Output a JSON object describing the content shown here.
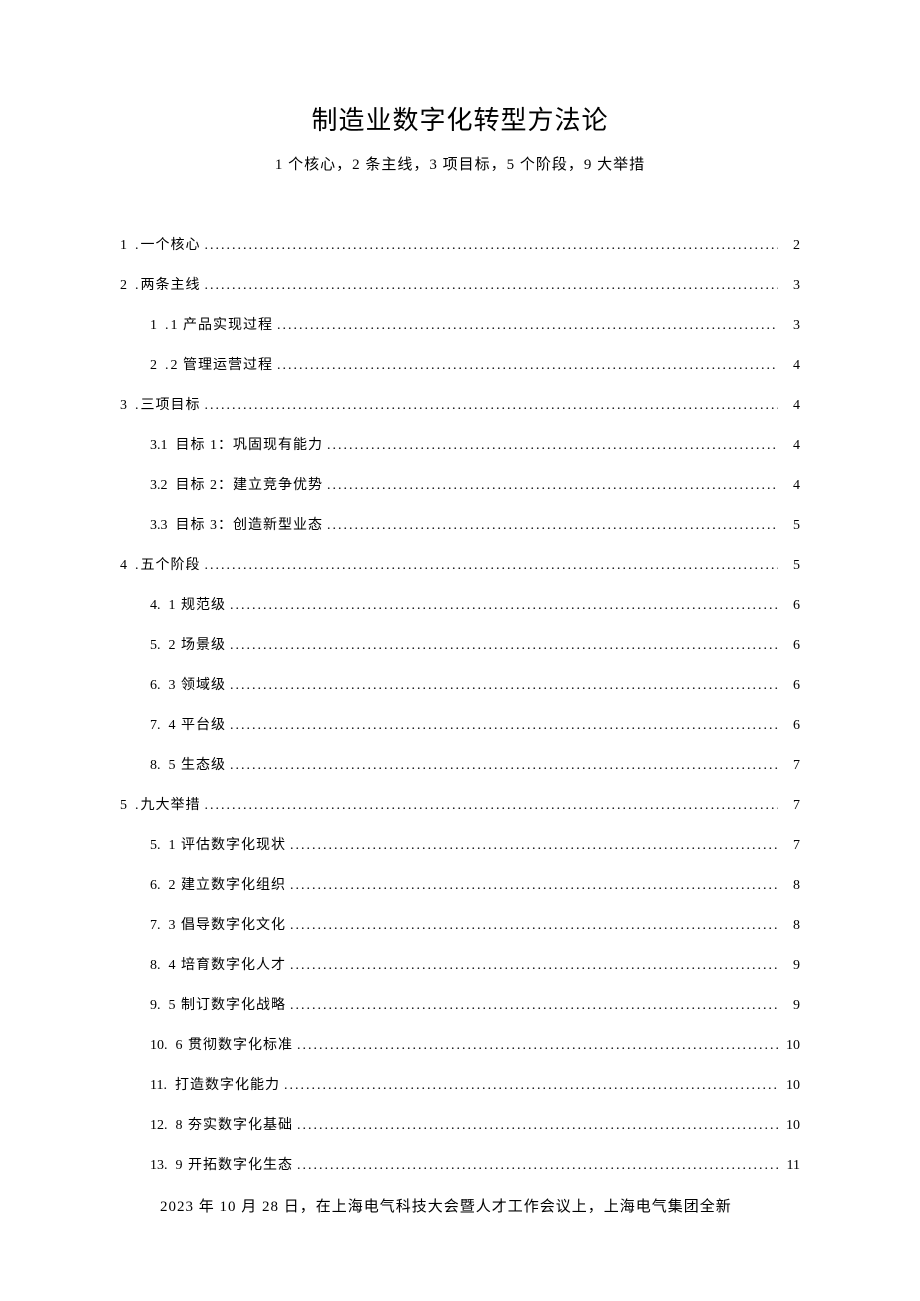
{
  "title": "制造业数字化转型方法论",
  "subtitle": "1 个核心，2 条主线，3 项目标，5 个阶段，9 大举措",
  "toc": [
    {
      "level": 1,
      "num": "1",
      "sep": "  .",
      "label": "一个核心",
      "page": "2"
    },
    {
      "level": 1,
      "num": "2",
      "sep": "  .",
      "label": "两条主线",
      "page": "3"
    },
    {
      "level": 2,
      "num": "1",
      "sep": "  .",
      "label": "1 产品实现过程",
      "page": "3"
    },
    {
      "level": 2,
      "num": "2",
      "sep": "  .",
      "label": "2 管理运营过程",
      "page": "4"
    },
    {
      "level": 1,
      "num": "3",
      "sep": "  .",
      "label": "三项目标",
      "page": "4"
    },
    {
      "level": 2,
      "num": "3.1",
      "sep": "",
      "label": "   目标 1：巩固现有能力",
      "page": "4"
    },
    {
      "level": 2,
      "num": "3.2",
      "sep": "",
      "label": "   目标 2：建立竞争优势",
      "page": "4"
    },
    {
      "level": 2,
      "num": "3.3",
      "sep": "",
      "label": "   目标 3：创造新型业态",
      "page": "5"
    },
    {
      "level": 1,
      "num": "4",
      "sep": "  .",
      "label": "五个阶段",
      "page": "5"
    },
    {
      "level": 2,
      "num": "4.",
      "sep": "",
      "label": "  1 规范级",
      "page": "6"
    },
    {
      "level": 2,
      "num": "5.",
      "sep": "",
      "label": "  2 场景级",
      "page": "6"
    },
    {
      "level": 2,
      "num": "6.",
      "sep": "",
      "label": "  3 领域级",
      "page": "6"
    },
    {
      "level": 2,
      "num": "7.",
      "sep": "",
      "label": "  4 平台级",
      "page": "6"
    },
    {
      "level": 2,
      "num": "8.",
      "sep": "",
      "label": "  5 生态级",
      "page": "7"
    },
    {
      "level": 1,
      "num": "5",
      "sep": "  .",
      "label": "九大举措",
      "page": "7"
    },
    {
      "level": 2,
      "num": "5.",
      "sep": "",
      "label": "  1 评估数字化现状",
      "page": "7"
    },
    {
      "level": 2,
      "num": "6.",
      "sep": "",
      "label": "  2 建立数字化组织",
      "page": "8"
    },
    {
      "level": 2,
      "num": "7.",
      "sep": "",
      "label": "  3 倡导数字化文化",
      "page": "8"
    },
    {
      "level": 2,
      "num": "8.",
      "sep": "",
      "label": "  4 培育数字化人才",
      "page": "9"
    },
    {
      "level": 2,
      "num": "9.",
      "sep": "",
      "label": "  5 制订数字化战略",
      "page": "9"
    },
    {
      "level": 2,
      "num": "10.",
      "sep": "",
      "label": "6 贯彻数字化标准",
      "page": "10"
    },
    {
      "level": 2,
      "num": "11.",
      "sep": "",
      "label": "   打造数字化能力",
      "page": "10"
    },
    {
      "level": 2,
      "num": "12.",
      "sep": "",
      "label": "8 夯实数字化基础",
      "page": "10"
    },
    {
      "level": 2,
      "num": "13.",
      "sep": "",
      "label": "9 开拓数字化生态",
      "page": "11"
    }
  ],
  "footer": "2023 年 10 月 28 日，在上海电气科技大会暨人才工作会议上，上海电气集团全新"
}
